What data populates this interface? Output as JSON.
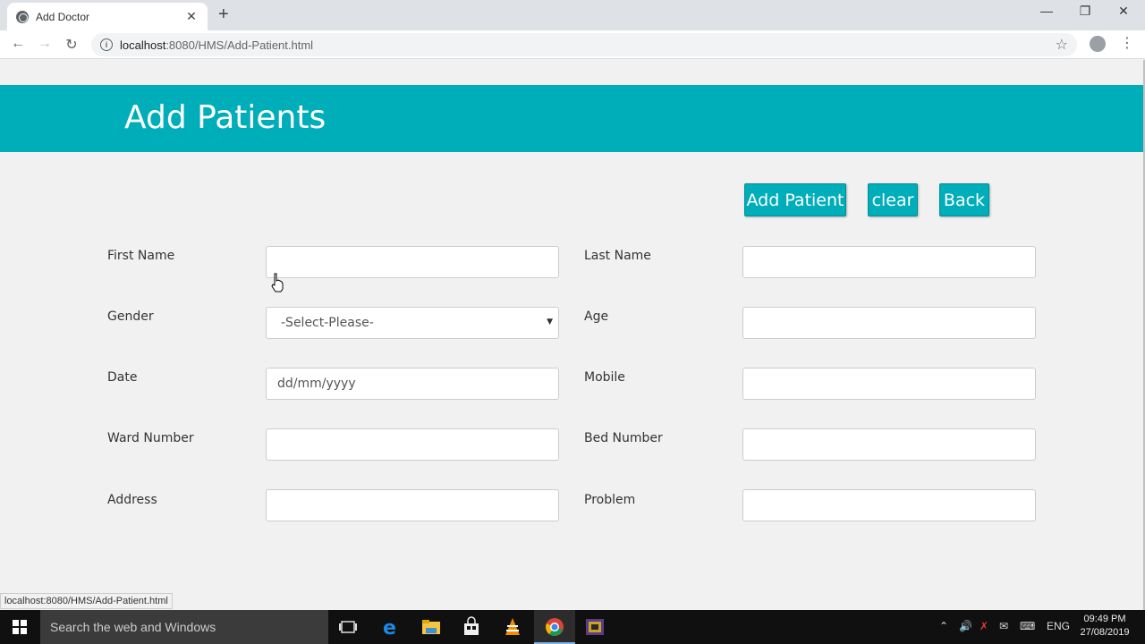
{
  "browser": {
    "tab_title": "Add Doctor",
    "new_tab": "+",
    "url_host": "localhost",
    "url_path": ":8080/HMS/Add-Patient.html",
    "status_url": "localhost:8080/HMS/Add-Patient.html"
  },
  "page": {
    "title": "Add Patients",
    "buttons": {
      "add": "Add Patient",
      "clear": "clear",
      "back": "Back"
    },
    "labels": {
      "first_name": "First Name",
      "last_name": "Last Name",
      "gender": "Gender",
      "age": "Age",
      "date": "Date",
      "mobile": "Mobile",
      "ward_number": "Ward Number",
      "bed_number": "Bed Number",
      "address": "Address",
      "problem": "Problem"
    },
    "fields": {
      "gender_selected": "-Select-Please-",
      "date_placeholder": "dd/mm/yyyy"
    },
    "accent_color": "#00aeb9"
  },
  "taskbar": {
    "search_placeholder": "Search the web and Windows",
    "language": "ENG",
    "time": "09:49 PM",
    "date": "27/08/2019"
  }
}
